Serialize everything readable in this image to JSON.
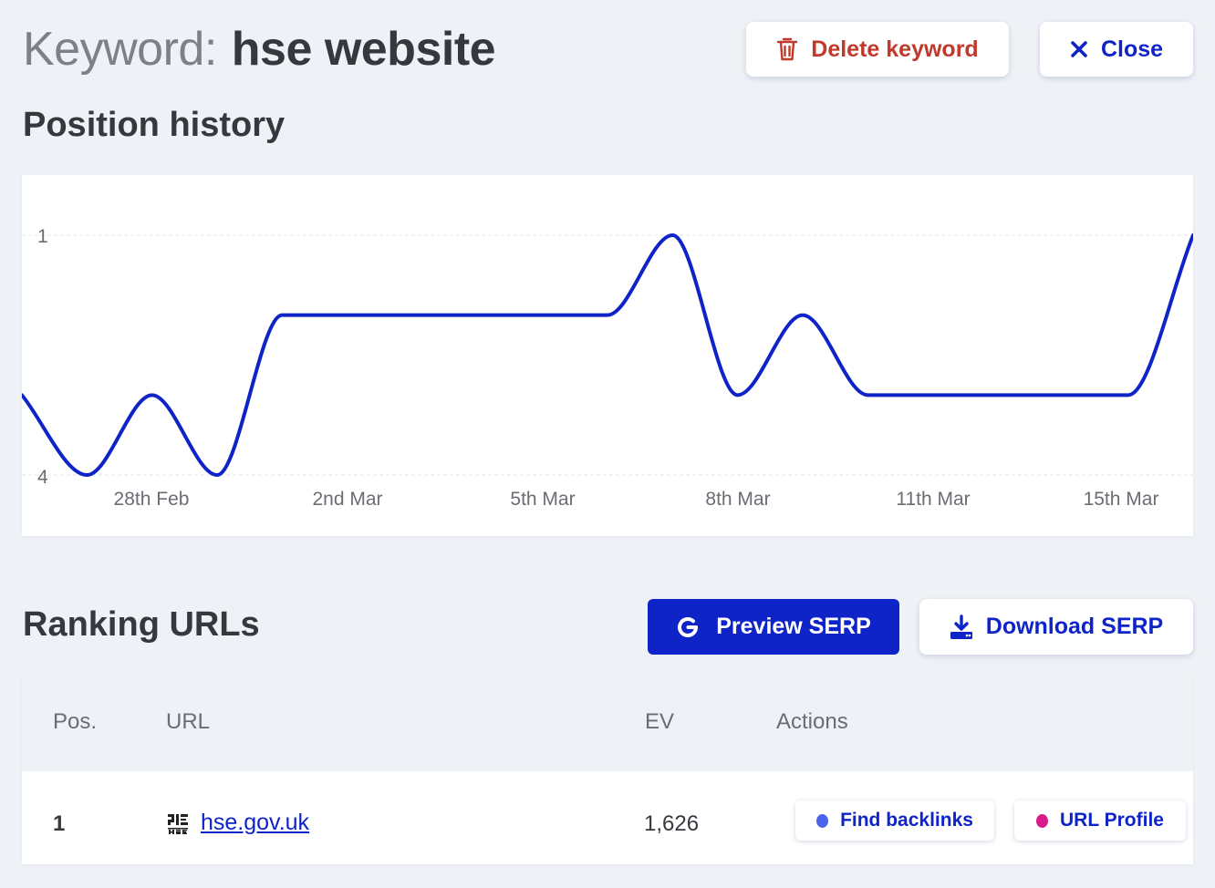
{
  "header": {
    "prefix": "Keyword:",
    "keyword": "hse website",
    "delete_label": "Delete keyword",
    "close_label": "Close"
  },
  "position_history": {
    "title": "Position history"
  },
  "chart_data": {
    "type": "line",
    "title": "",
    "xlabel": "",
    "ylabel": "",
    "y_inverted": true,
    "ylim": [
      1,
      4
    ],
    "y_ticks": [
      "1",
      "4"
    ],
    "x_tick_labels": [
      "28th Feb",
      "2nd Mar",
      "5th Mar",
      "8th Mar",
      "11th Mar",
      "15th Mar"
    ],
    "grid": true,
    "series": [
      {
        "color": "#0f24c8",
        "values": [
          3,
          4,
          3,
          4,
          2,
          2,
          2,
          2,
          2,
          2,
          1,
          3,
          2,
          3,
          3,
          3,
          3,
          3,
          1
        ]
      }
    ]
  },
  "ranking": {
    "title": "Ranking URLs",
    "preview_label": "Preview SERP",
    "download_label": "Download SERP",
    "columns": [
      "Pos.",
      "URL",
      "EV",
      "Actions"
    ],
    "rows": [
      {
        "pos": "1",
        "url": "hse.gov.uk",
        "ev": "1,626",
        "backlinks_label": "Find backlinks",
        "profile_label": "URL Profile"
      }
    ]
  },
  "colors": {
    "accent": "#0f24c8",
    "danger": "#c0392b",
    "backlinks_dot": "#4a63e8",
    "profile_dot": "#d81b8a"
  }
}
